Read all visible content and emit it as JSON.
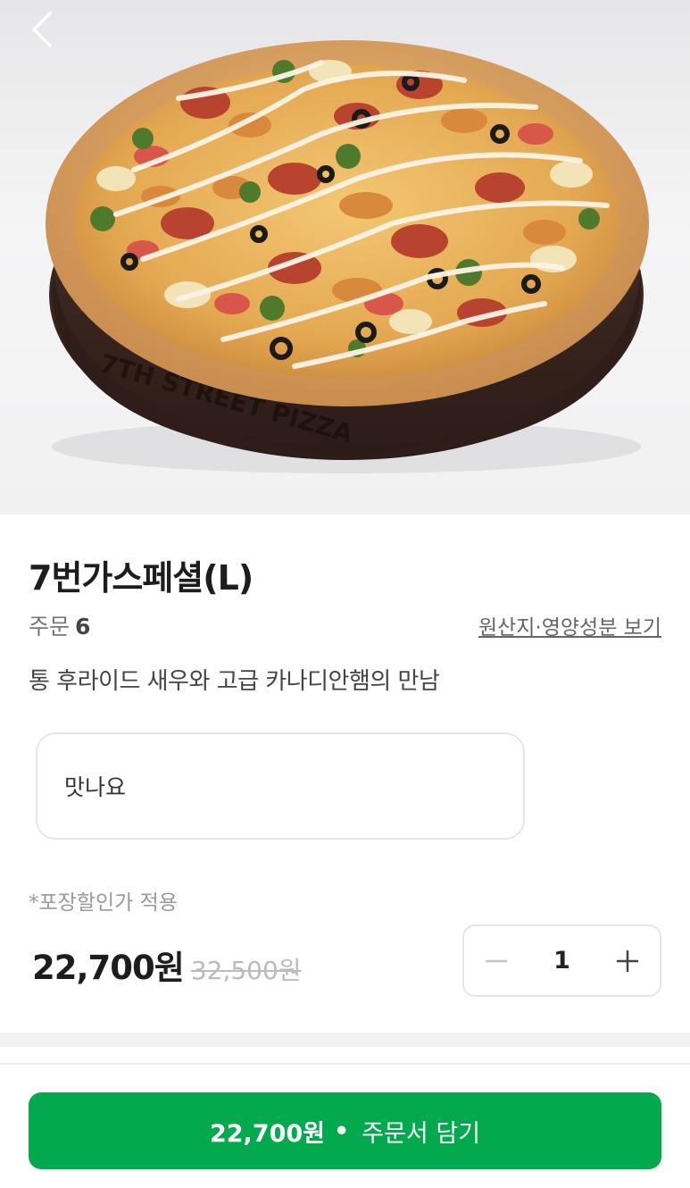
{
  "header": {
    "back_icon": "chevron-left-icon"
  },
  "product": {
    "image": "pizza-photo",
    "image_text": "7TH STREET PIZZA",
    "name": "7번가스페셜(L)",
    "order_label": "주문",
    "order_count": "6",
    "origin_link": "원산지·영양성분 보기",
    "description": "통 후라이드 새우와 고급 카나디안햄의 만남",
    "review": "맛나요"
  },
  "pricing": {
    "discount_note": "*포장할인가 적용",
    "current_price": "22,700원",
    "original_price": "32,500원"
  },
  "quantity": {
    "value": "1",
    "minus_icon": "minus-icon",
    "plus_icon": "plus-icon"
  },
  "cart_button": {
    "price": "22,700원",
    "separator": "•",
    "label": "주문서 담기"
  },
  "colors": {
    "accent": "#03a94d",
    "text": "#1d1d1d",
    "muted": "#999999",
    "border": "#e6e6e6"
  }
}
